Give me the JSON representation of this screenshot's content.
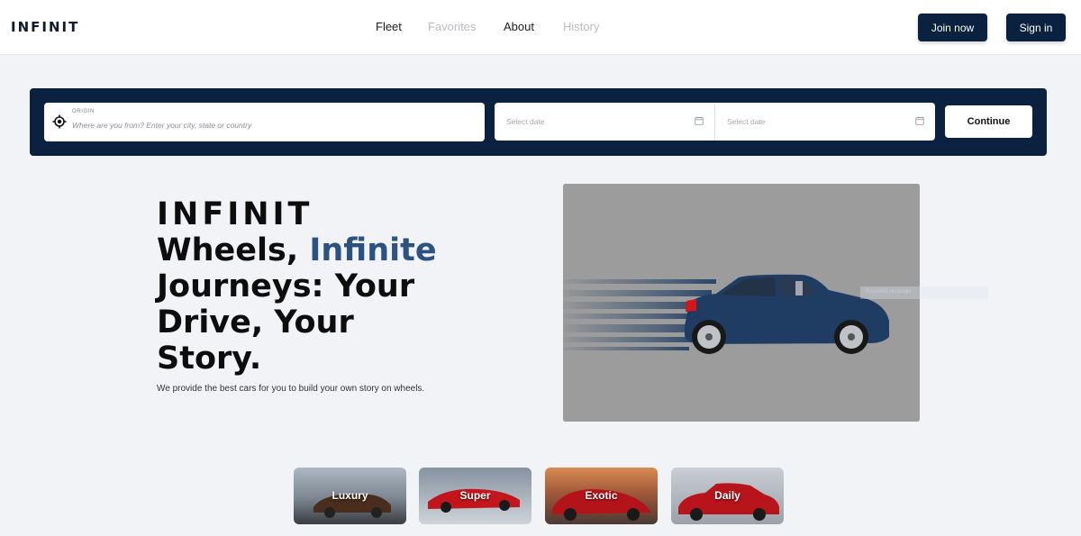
{
  "nav": {
    "logo": "INFINIT",
    "links": [
      {
        "label": "Fleet",
        "active": true
      },
      {
        "label": "Favorites",
        "active": false
      },
      {
        "label": "About",
        "active": true
      },
      {
        "label": "History",
        "active": false
      }
    ],
    "join_label": "Join now",
    "signin_label": "Sign in"
  },
  "search": {
    "origin_label": "ORIGIN",
    "origin_placeholder": "Where are you from? Enter your city, state or country",
    "start_date_placeholder": "Select date",
    "end_date_placeholder": "Select date",
    "continue_label": "Continue"
  },
  "hero": {
    "title_brand": "INFINIT",
    "title_line_a": "Wheels, ",
    "title_accent": "Infinite",
    "title_rest": "Journeys: Your Drive, Your Story.",
    "subtitle": "We provide the best cars for you to build your own story on wheels.",
    "ghost_text": "Rounded rectangle"
  },
  "categories": [
    {
      "label": "Luxury"
    },
    {
      "label": "Super"
    },
    {
      "label": "Exotic"
    },
    {
      "label": "Daily"
    }
  ],
  "colors": {
    "navy": "#0b2140",
    "accent": "#2c5282",
    "background": "#f2f3f6",
    "car_blue": "#1f3d63",
    "car_red": "#c3161c"
  }
}
